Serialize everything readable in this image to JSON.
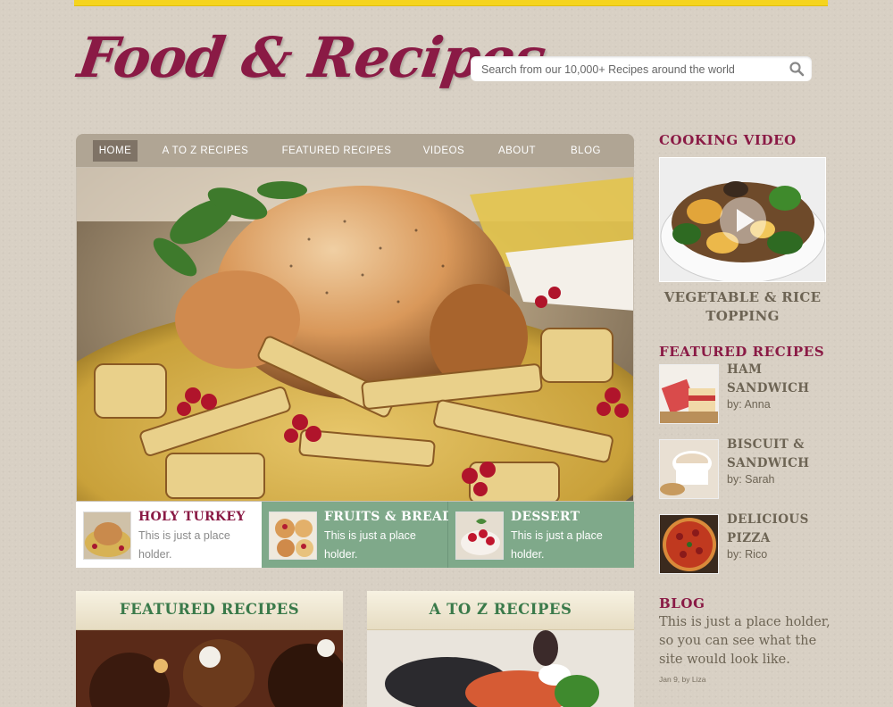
{
  "site": {
    "logo": "Food & Recipes"
  },
  "search": {
    "placeholder": "Search from our 10,000+ Recipes around the world",
    "icon": "search-icon"
  },
  "nav": {
    "items": [
      {
        "label": "HOME",
        "active": true
      },
      {
        "label": "A TO Z RECIPES"
      },
      {
        "label": "FEATURED RECIPES"
      },
      {
        "label": "VIDEOS"
      },
      {
        "label": "ABOUT"
      },
      {
        "label": "BLOG"
      }
    ]
  },
  "tabs": [
    {
      "title": "HOLY TURKEY",
      "desc": "This is just a place holder."
    },
    {
      "title": "FRUITS & BREAD",
      "desc": "This is just a place holder."
    },
    {
      "title": "DESSERT",
      "desc": "This is just a place holder."
    }
  ],
  "boxes": [
    {
      "title": "FEATURED RECIPES"
    },
    {
      "title": "A TO Z RECIPES"
    }
  ],
  "sidebar": {
    "video": {
      "heading": "COOKING VIDEO",
      "caption": "VEGETABLE & RICE TOPPING"
    },
    "featured": {
      "heading": "FEATURED RECIPES",
      "items": [
        {
          "name": "HAM SANDWICH",
          "by": "by: Anna"
        },
        {
          "name": "BISCUIT & SANDWICH",
          "by": "by: Sarah"
        },
        {
          "name": "DELICIOUS PIZZA",
          "by": "by: Rico"
        }
      ]
    },
    "blog": {
      "heading": "BLOG",
      "text": "This is just a place holder, so you can see what the site would look like.",
      "meta": "Jan 9, by Liza"
    }
  },
  "colors": {
    "accent": "#8a1a45",
    "green": "#7fa98a",
    "nav": "#b0a594",
    "topbar": "#f5d41e"
  }
}
